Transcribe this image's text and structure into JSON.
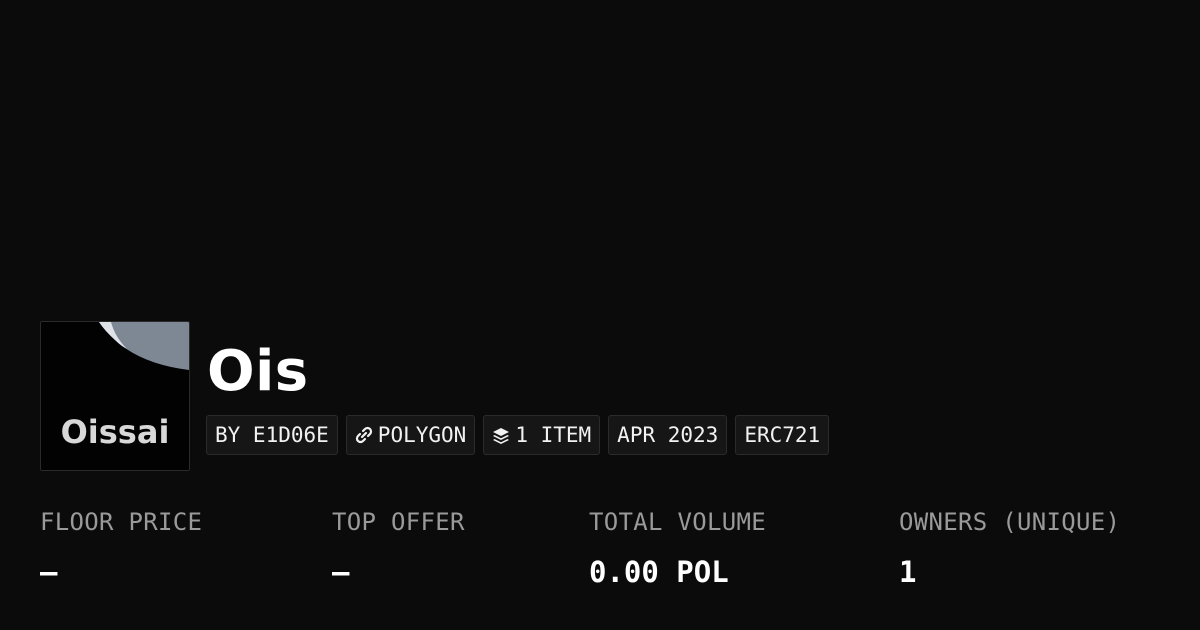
{
  "collection": {
    "name": "Ois",
    "avatar_text": "Oissai"
  },
  "tags": [
    {
      "label": "BY E1D06E",
      "icon": ""
    },
    {
      "label": "POLYGON",
      "icon": "chain-link-icon"
    },
    {
      "label": "1 ITEM",
      "icon": "layers-icon"
    },
    {
      "label": "APR 2023",
      "icon": ""
    },
    {
      "label": "ERC721",
      "icon": ""
    }
  ],
  "stats": {
    "floor_price": {
      "label": "FLOOR PRICE",
      "value": "–"
    },
    "top_offer": {
      "label": "TOP OFFER",
      "value": "–"
    },
    "total_volume": {
      "label": "TOTAL VOLUME",
      "value": "0.00 POL"
    },
    "owners": {
      "label": "OWNERS (UNIQUE)",
      "value": "1"
    }
  },
  "colors": {
    "background": "#0b0b0b",
    "tag_background": "#161616",
    "label_gray": "#9a9a9a",
    "text_white": "#ffffff"
  }
}
